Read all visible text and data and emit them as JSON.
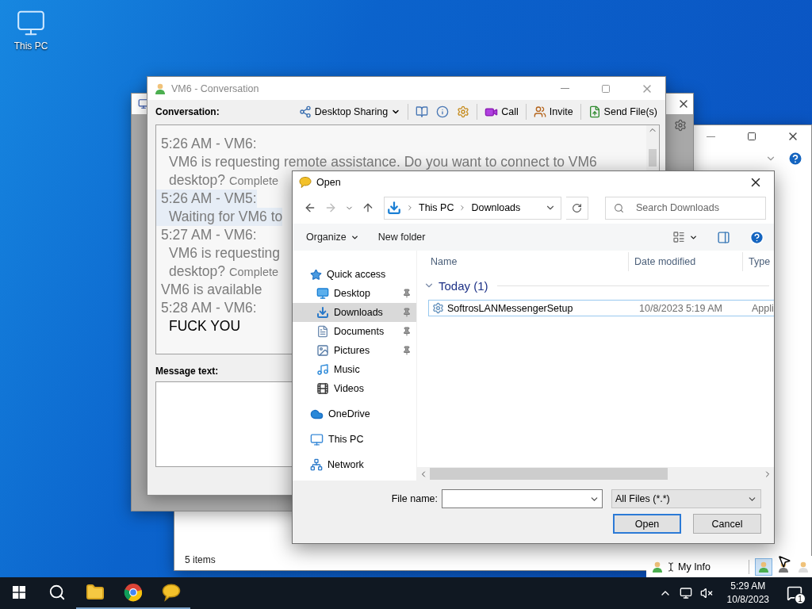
{
  "desktop": {
    "icons": [
      {
        "label": "This PC"
      }
    ]
  },
  "explorer_window": {
    "status_bar": "5 items"
  },
  "messenger_bar": {
    "my_info": "My Info",
    "status_buttons": [
      {
        "selected": true
      },
      {
        "selected": false
      },
      {
        "selected": false
      }
    ]
  },
  "conversation": {
    "title": "VM6 - Conversation",
    "toolbar_label": "Conversation:",
    "toolbar": [
      {
        "kind": "menu",
        "label": "Desktop Sharing",
        "separator_before": false
      },
      {
        "kind": "icon",
        "separator_before": true
      },
      {
        "kind": "icon",
        "separator_before": false
      },
      {
        "kind": "icon",
        "separator_before": false
      },
      {
        "kind": "button",
        "label": "Call",
        "separator_before": true
      },
      {
        "kind": "button",
        "label": "Invite",
        "separator_before": true
      },
      {
        "kind": "button",
        "label": "Send File(s)",
        "separator_before": true
      }
    ],
    "chat": [
      {
        "kind": "header",
        "text": "5:26 AM - VM6:",
        "faded": true,
        "highlighted": false
      },
      {
        "kind": "body",
        "text": "VM6 is requesting remote assistance. Do you want to connect to VM6",
        "faded": true,
        "highlighted": false
      },
      {
        "kind": "body",
        "text": "desktop?",
        "note": "Complete",
        "faded": true,
        "highlighted": false
      },
      {
        "kind": "header",
        "text": "5:26 AM - VM5:",
        "faded": true,
        "highlighted": true
      },
      {
        "kind": "body",
        "text": "Waiting for VM6 to",
        "faded": true,
        "highlighted": true
      },
      {
        "kind": "header",
        "text": "5:27 AM - VM6:",
        "faded": true,
        "highlighted": false
      },
      {
        "kind": "body",
        "text": "VM6 is requesting",
        "faded": true,
        "highlighted": false
      },
      {
        "kind": "body",
        "text": "desktop?",
        "note": "Complete",
        "faded": true,
        "highlighted": false
      },
      {
        "kind": "status",
        "text": "VM6 is available",
        "faded": true,
        "highlighted": false
      },
      {
        "kind": "header",
        "text": "5:28 AM - VM6:",
        "faded": true,
        "highlighted": false
      },
      {
        "kind": "body",
        "text": "FUCK YOU",
        "faded": false,
        "highlighted": false
      }
    ],
    "message_label": "Message text:"
  },
  "dialog": {
    "title": "Open",
    "path": [
      "This PC",
      "Downloads"
    ],
    "search": {
      "placeholder": "Search Downloads"
    },
    "commands": [
      {
        "kind": "menu",
        "label": "Organize"
      },
      {
        "kind": "button",
        "label": "New folder"
      }
    ],
    "nav": [
      {
        "kind": "star",
        "label": "Quick access",
        "pinned": false,
        "selected": false,
        "children": [
          {
            "kind": "desktop",
            "label": "Desktop",
            "pinned": true,
            "selected": false
          },
          {
            "kind": "download",
            "label": "Downloads",
            "pinned": true,
            "selected": true
          },
          {
            "kind": "documents",
            "label": "Documents",
            "pinned": true,
            "selected": false
          },
          {
            "kind": "pictures",
            "label": "Pictures",
            "pinned": true,
            "selected": false
          },
          {
            "kind": "music",
            "label": "Music",
            "pinned": false,
            "selected": false
          },
          {
            "kind": "videos",
            "label": "Videos",
            "pinned": false,
            "selected": false
          }
        ]
      },
      {
        "kind": "cloud",
        "label": "OneDrive",
        "pinned": false,
        "selected": false
      },
      {
        "kind": "pc",
        "label": "This PC",
        "pinned": false,
        "selected": false
      },
      {
        "kind": "network",
        "label": "Network",
        "pinned": false,
        "selected": false
      }
    ],
    "columns": [
      "Name",
      "Date modified",
      "Type"
    ],
    "groups": [
      {
        "label": "Today (1)",
        "expanded": true,
        "files": [
          {
            "name": "SoftrosLANMessengerSetup",
            "date_modified": "10/8/2023 5:19 AM",
            "type": "Appli",
            "focused": true
          }
        ]
      }
    ],
    "file_name_label": "File name:",
    "file_type": "All Files (*.*)",
    "buttons": [
      {
        "label": "Open",
        "default": true
      },
      {
        "label": "Cancel",
        "default": false
      }
    ]
  },
  "taskbar": {
    "apps": [
      {
        "kind": "search",
        "open": false
      },
      {
        "kind": "files",
        "open": true
      },
      {
        "kind": "browser",
        "open": true
      },
      {
        "kind": "messenger",
        "open": true
      }
    ],
    "time": "5:29 AM",
    "date": "10/8/2023",
    "notifications": "1"
  }
}
